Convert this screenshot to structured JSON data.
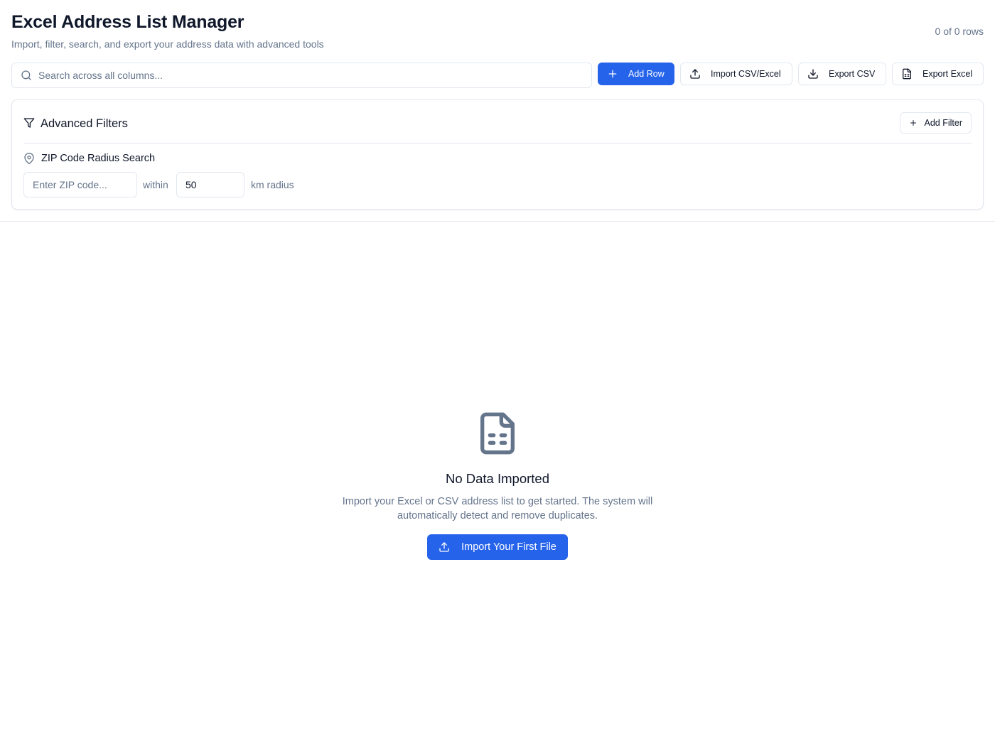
{
  "header": {
    "title": "Excel Address List Manager",
    "subtitle": "Import, filter, search, and export your address data with advanced tools",
    "row_count": "0 of 0 rows"
  },
  "toolbar": {
    "search_placeholder": "Search across all columns...",
    "add_row_label": "Add Row",
    "import_label": "Import CSV/Excel",
    "export_csv_label": "Export CSV",
    "export_excel_label": "Export Excel"
  },
  "filters": {
    "title": "Advanced Filters",
    "add_filter_label": "Add Filter",
    "zip_section_label": "ZIP Code Radius Search",
    "zip_placeholder": "Enter ZIP code...",
    "within_label": "within",
    "radius_value": "50",
    "radius_unit_label": "km radius"
  },
  "empty_state": {
    "title": "No Data Imported",
    "description": "Import your Excel or CSV address list to get started. The system will automatically detect and remove duplicates.",
    "button_label": "Import Your First File"
  },
  "icons": {
    "search": "search-icon",
    "add_row": "plus-icon",
    "import": "upload-icon",
    "export_csv": "download-icon",
    "export_excel": "file-spreadsheet-icon",
    "filters": "filter-icon",
    "add_filter": "plus-icon",
    "zip": "map-pin-icon",
    "empty": "file-spreadsheet-icon",
    "import_first": "upload-icon"
  },
  "colors": {
    "primary": "#2563eb",
    "text": "#0f172a",
    "muted": "#64748b",
    "border": "#e2e8f0"
  }
}
